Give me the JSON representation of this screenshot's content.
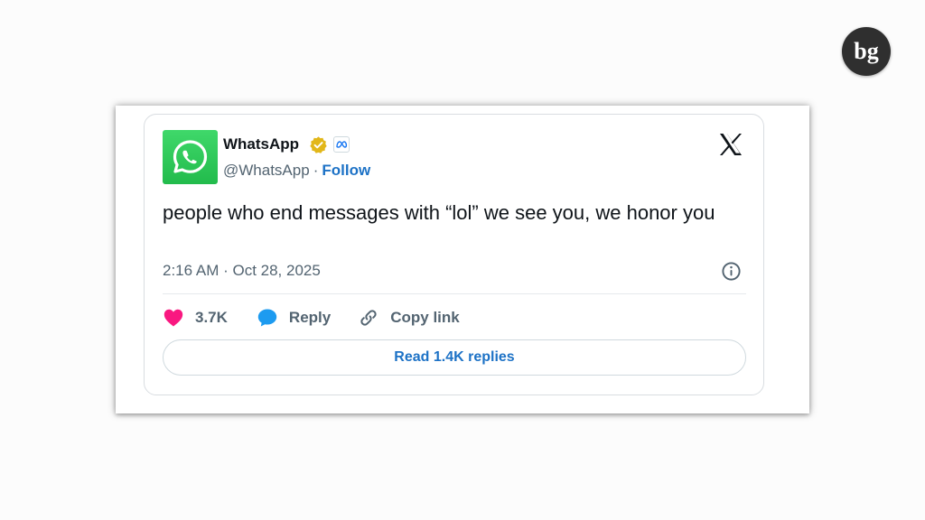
{
  "site": {
    "logo_text": "bg"
  },
  "tweet": {
    "author": {
      "name": "WhatsApp",
      "handle": "@WhatsApp",
      "separator": "·",
      "follow_label": "Follow",
      "avatar_icon": "whatsapp-logo-icon",
      "verified_icon": "gold-verified-badge-icon",
      "affiliate_icon": "meta-affiliate-badge-icon"
    },
    "platform_icon": "x-logo-icon",
    "text": "people who end messages with “lol” we see you, we honor you",
    "timestamp": "2:16 AM · Oct 28, 2025",
    "info_icon": "info-icon",
    "actions": {
      "like_count": "3.7K",
      "reply_label": "Reply",
      "copy_link_label": "Copy link"
    },
    "read_replies_label": "Read 1.4K replies"
  },
  "colors": {
    "heart": "#f91880",
    "reply_bubble": "#1d9bf0",
    "link_blue": "#1d72c6",
    "verified_gold": "#e2b719",
    "whatsapp_green": "#25d366"
  }
}
